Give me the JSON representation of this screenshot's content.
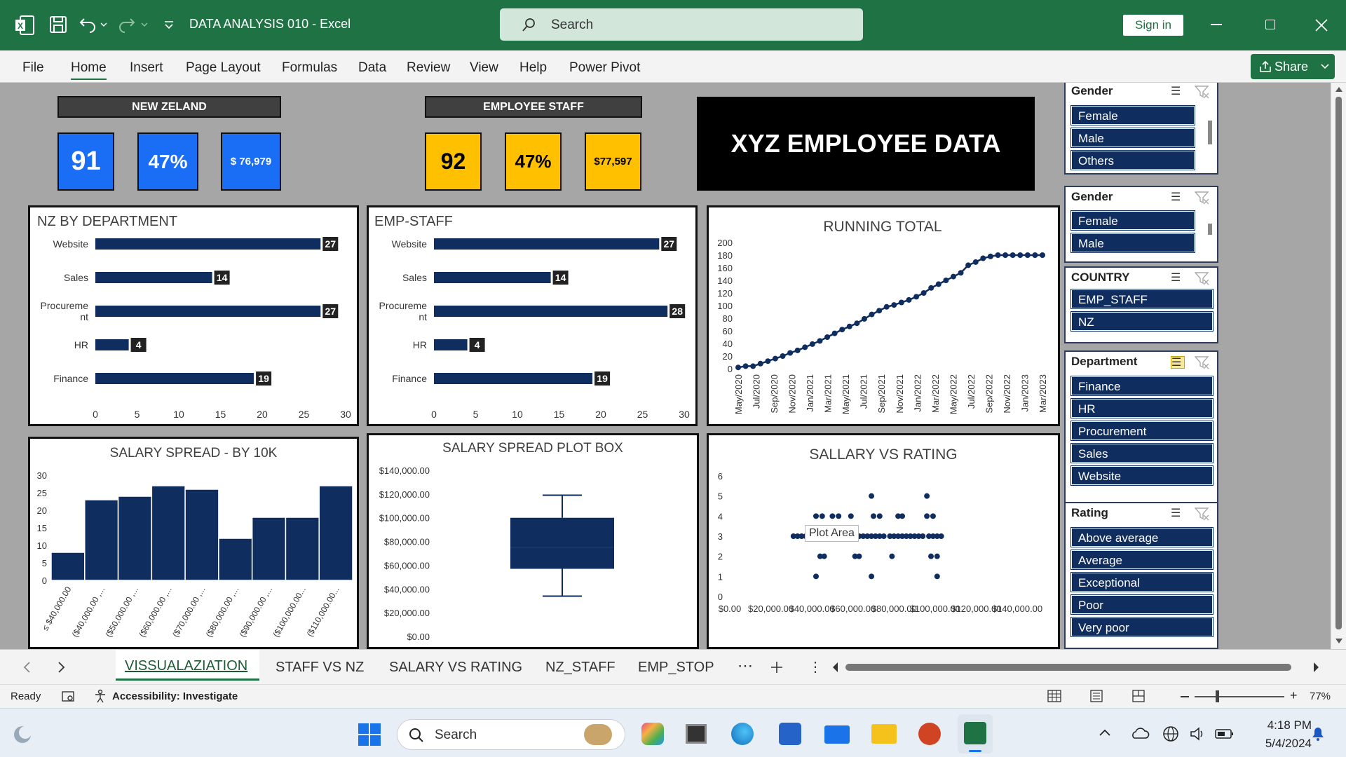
{
  "titlebar": {
    "doc_title": "DATA ANALYSIS 010  -  Excel",
    "search_placeholder": "Search",
    "sign_in": "Sign in"
  },
  "ribbon": {
    "tabs": [
      "File",
      "Home",
      "Insert",
      "Page Layout",
      "Formulas",
      "Data",
      "Review",
      "View",
      "Help",
      "Power Pivot"
    ],
    "share": "Share"
  },
  "dashboard": {
    "nz_header": "NEW ZELAND",
    "emp_header": "EMPLOYEE STAFF",
    "title": "XYZ EMPLOYEE DATA",
    "nz_kpis": [
      "91",
      "47%",
      "$ 76,979"
    ],
    "emp_kpis": [
      "92",
      "47%",
      "$77,597"
    ],
    "tooltip": "Plot Area"
  },
  "chart_data": [
    {
      "type": "bar",
      "title": "NZ BY DEPARTMENT",
      "categories": [
        "Website",
        "Sales",
        "Procurement",
        "HR",
        "Finance"
      ],
      "category_display": [
        "Website",
        "Sales",
        "Procureme|nt",
        "HR",
        "Finance"
      ],
      "values": [
        27,
        14,
        27,
        4,
        19
      ],
      "xlim": [
        0,
        30
      ],
      "x_ticks": [
        "0",
        "5",
        "10",
        "15",
        "20",
        "25",
        "30"
      ]
    },
    {
      "type": "bar",
      "title": "EMP-STAFF",
      "categories": [
        "Website",
        "Sales",
        "Procurement",
        "HR",
        "Finance"
      ],
      "category_display": [
        "Website",
        "Sales",
        "Procureme|nt",
        "HR",
        "Finance"
      ],
      "values": [
        27,
        14,
        28,
        4,
        19
      ],
      "xlim": [
        0,
        30
      ],
      "x_ticks": [
        "0",
        "5",
        "10",
        "15",
        "20",
        "25",
        "30"
      ]
    },
    {
      "type": "line",
      "title": "RUNNING TOTAL",
      "x_labels": [
        "May/2020",
        "Jul/2020",
        "Sep/2020",
        "Nov/2020",
        "Jan/2021",
        "Mar/2021",
        "May/2021",
        "Jul/2021",
        "Sep/2021",
        "Nov/2021",
        "Jan/2022",
        "Mar/2022",
        "May/2022",
        "Jul/2022",
        "Sep/2022",
        "Nov/2022",
        "Jan/2023",
        "Mar/2023"
      ],
      "values": [
        2,
        4,
        4,
        8,
        12,
        16,
        20,
        25,
        29,
        34,
        39,
        44,
        50,
        56,
        62,
        67,
        72,
        79,
        86,
        92,
        98,
        101,
        105,
        109,
        114,
        120,
        128,
        134,
        140,
        146,
        152,
        164,
        169,
        175,
        178,
        180,
        180,
        180,
        180,
        180,
        180,
        180
      ],
      "ylim": [
        0,
        200
      ],
      "y_ticks": [
        "0",
        "20",
        "40",
        "60",
        "80",
        "100",
        "120",
        "140",
        "160",
        "180",
        "200"
      ]
    },
    {
      "type": "bar",
      "title": "SALARY SPREAD - BY 10K",
      "categories": [
        "$40,000.00",
        "($40,000.00 ...",
        "($50,000.00 ...",
        "($60,000.00 ...",
        "($70,000.00 ...",
        "($80,000.00 ...",
        "($90,000.00 ...",
        "($100,000.00...",
        "($110,000.00..."
      ],
      "category_display": [
        "≤ $40,000.00",
        "($40,000.00 ,...",
        "($50,000.00 ,...",
        "($60,000.00 ,...",
        "($70,000.00 ,...",
        "($80,000.00 ,...",
        "($90,000.00 ,...",
        "($100,000.00...",
        "($110,000.00..."
      ],
      "values": [
        8,
        23,
        24,
        27,
        26,
        12,
        18,
        18,
        27
      ],
      "ylim": [
        0,
        30
      ],
      "y_ticks": [
        "0",
        "5",
        "10",
        "15",
        "20",
        "25",
        "30"
      ]
    },
    {
      "type": "box",
      "title": "SALARY SPREAD PLOT BOX",
      "min": 34000,
      "q1": 57000,
      "median": 75000,
      "q3": 100000,
      "max": 119000,
      "ylim": [
        0,
        140000
      ],
      "y_ticks": [
        "$0.00",
        "$20,000.00",
        "$40,000.00",
        "$60,000.00",
        "$80,000.00",
        "$100,000.00",
        "$120,000.00",
        "$140,000.00"
      ]
    },
    {
      "type": "scatter",
      "title": "SALLARY VS RATING",
      "xlim": [
        0,
        140000
      ],
      "ylim": [
        0,
        6
      ],
      "x_ticks": [
        "$0.00",
        "$20,000.00",
        "$40,000.00",
        "$60,000.00",
        "$80,000.00",
        "$100,000.00",
        "$120,000.00",
        "$140,000.00"
      ],
      "y_ticks": [
        "0",
        "1",
        "2",
        "3",
        "4",
        "5",
        "6"
      ],
      "points": [
        [
          42000,
          1
        ],
        [
          69000,
          1
        ],
        [
          101000,
          1
        ],
        [
          44000,
          2
        ],
        [
          46000,
          2
        ],
        [
          61000,
          2
        ],
        [
          63000,
          2
        ],
        [
          79000,
          2
        ],
        [
          98000,
          2
        ],
        [
          101000,
          2
        ],
        [
          31000,
          3
        ],
        [
          33000,
          3
        ],
        [
          35000,
          3
        ],
        [
          37000,
          3
        ],
        [
          39000,
          3
        ],
        [
          41000,
          3
        ],
        [
          43000,
          3
        ],
        [
          45000,
          3
        ],
        [
          47000,
          3
        ],
        [
          49000,
          3
        ],
        [
          51000,
          3
        ],
        [
          53000,
          3
        ],
        [
          55000,
          3
        ],
        [
          57000,
          3
        ],
        [
          59000,
          3
        ],
        [
          61000,
          3
        ],
        [
          63000,
          3
        ],
        [
          65000,
          3
        ],
        [
          67000,
          3
        ],
        [
          69000,
          3
        ],
        [
          71000,
          3
        ],
        [
          73000,
          3
        ],
        [
          75000,
          3
        ],
        [
          78000,
          3
        ],
        [
          80000,
          3
        ],
        [
          82000,
          3
        ],
        [
          84000,
          3
        ],
        [
          86000,
          3
        ],
        [
          88000,
          3
        ],
        [
          90000,
          3
        ],
        [
          92000,
          3
        ],
        [
          94000,
          3
        ],
        [
          97000,
          3
        ],
        [
          99000,
          3
        ],
        [
          101000,
          3
        ],
        [
          103000,
          3
        ],
        [
          42000,
          4
        ],
        [
          45000,
          4
        ],
        [
          50000,
          4
        ],
        [
          53000,
          4
        ],
        [
          59000,
          4
        ],
        [
          70000,
          4
        ],
        [
          73000,
          4
        ],
        [
          82000,
          4
        ],
        [
          84000,
          4
        ],
        [
          96000,
          4
        ],
        [
          99000,
          4
        ],
        [
          69000,
          5
        ],
        [
          96000,
          5
        ]
      ]
    }
  ],
  "slicers": [
    {
      "title": "Gender",
      "items": [
        "Female",
        "Male",
        "Others"
      ]
    },
    {
      "title": "Gender",
      "items": [
        "Female",
        "Male"
      ]
    },
    {
      "title": "COUNTRY",
      "items": [
        "EMP_STAFF",
        "NZ"
      ]
    },
    {
      "title": "Department",
      "items": [
        "Finance",
        "HR",
        "Procurement",
        "Sales",
        "Website"
      ]
    },
    {
      "title": "Rating",
      "items": [
        "Above average",
        "Average",
        "Exceptional",
        "Poor",
        "Very poor"
      ]
    }
  ],
  "sheet_tabs": [
    "VISSUALAZIATION",
    "STAFF VS NZ",
    "SALARY VS RATING",
    "NZ_STAFF",
    "EMP_STOP"
  ],
  "status": {
    "ready": "Ready",
    "accessibility": "Accessibility: Investigate",
    "zoom": "77%"
  },
  "taskbar": {
    "search": "Search",
    "time": "4:18 PM",
    "date": "5/4/2024"
  },
  "colors": {
    "excel_green": "#1f7244",
    "bar_navy": "#0f2d5e",
    "kpi_blue": "#1a6ef5",
    "kpi_gold": "#ffc000"
  }
}
